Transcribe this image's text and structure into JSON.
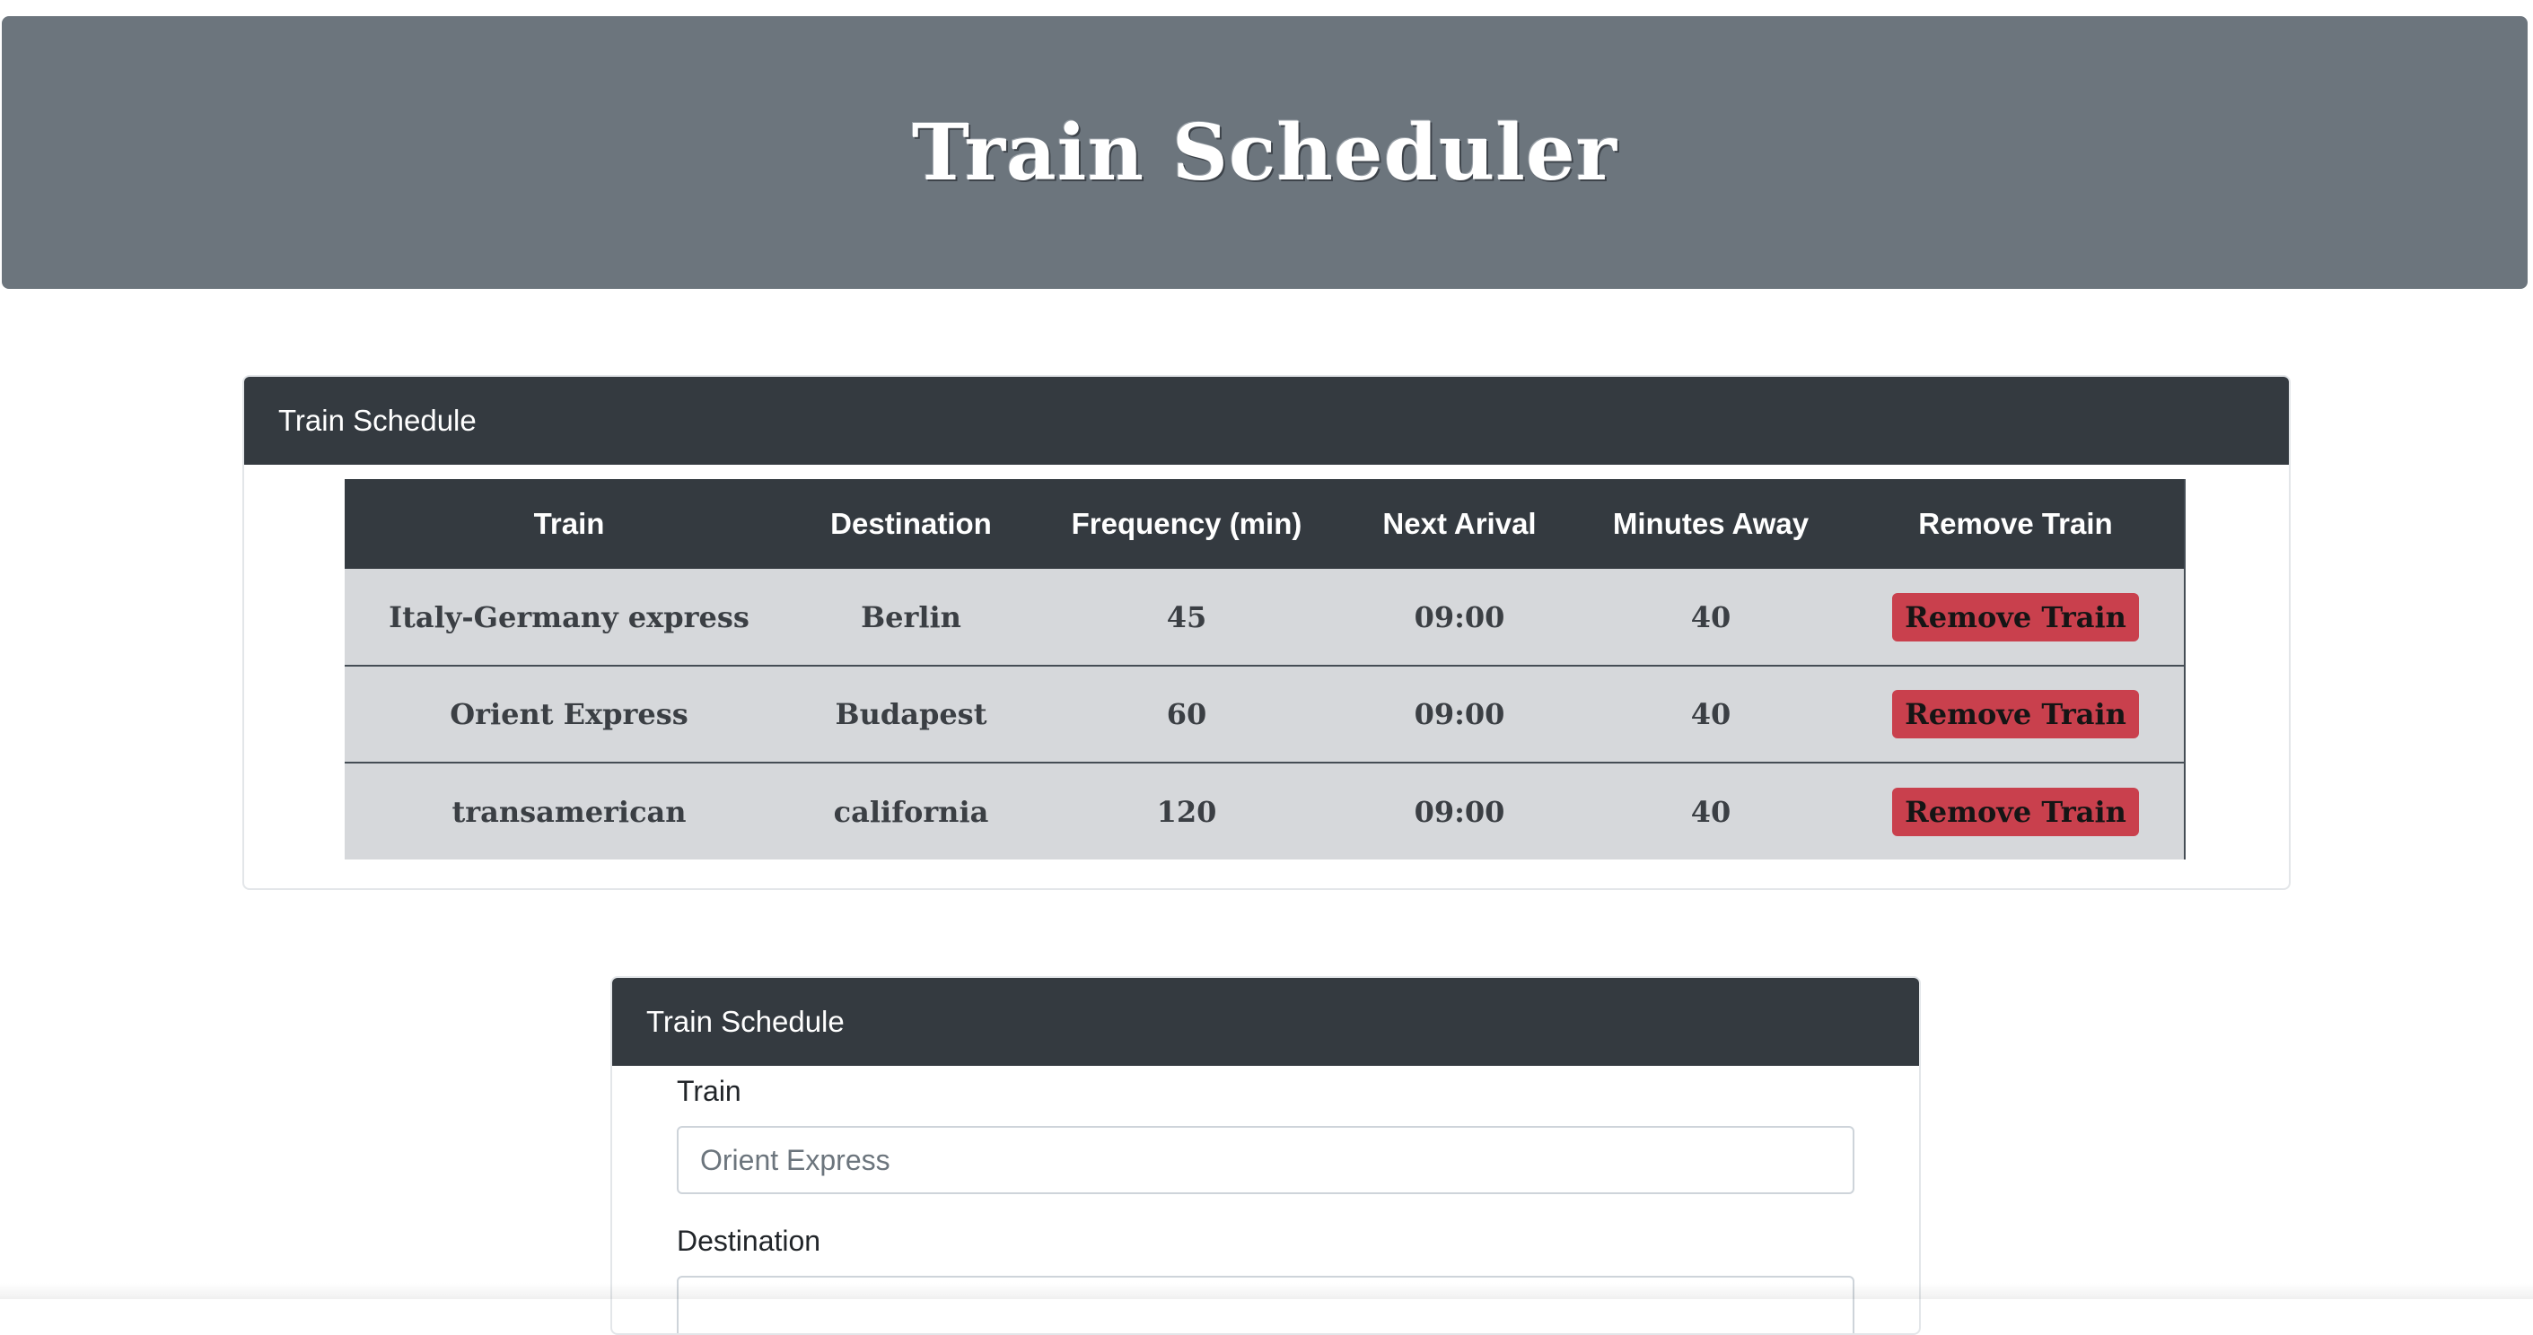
{
  "header": {
    "title": "Train Scheduler"
  },
  "schedule_card": {
    "header": "Train Schedule",
    "columns": [
      "Train",
      "Destination",
      "Frequency (min)",
      "Next Arival",
      "Minutes Away",
      "Remove Train"
    ],
    "rows": [
      {
        "train": "Italy-Germany express",
        "destination": "Berlin",
        "frequency": "45",
        "next_arrival": "09:00",
        "minutes_away": "40",
        "remove_label": "Remove Train"
      },
      {
        "train": "Orient Express",
        "destination": "Budapest",
        "frequency": "60",
        "next_arrival": "09:00",
        "minutes_away": "40",
        "remove_label": "Remove Train"
      },
      {
        "train": "transamerican",
        "destination": "california",
        "frequency": "120",
        "next_arrival": "09:00",
        "minutes_away": "40",
        "remove_label": "Remove Train"
      }
    ]
  },
  "form_card": {
    "header": "Train Schedule",
    "train_label": "Train",
    "train_placeholder": "Orient Express",
    "destination_label": "Destination",
    "destination_placeholder": ""
  },
  "colors": {
    "jumbotron": "#6c757d",
    "card_header": "#343a40",
    "table_row": "#d6d8db",
    "remove_button": "#c9404d"
  }
}
